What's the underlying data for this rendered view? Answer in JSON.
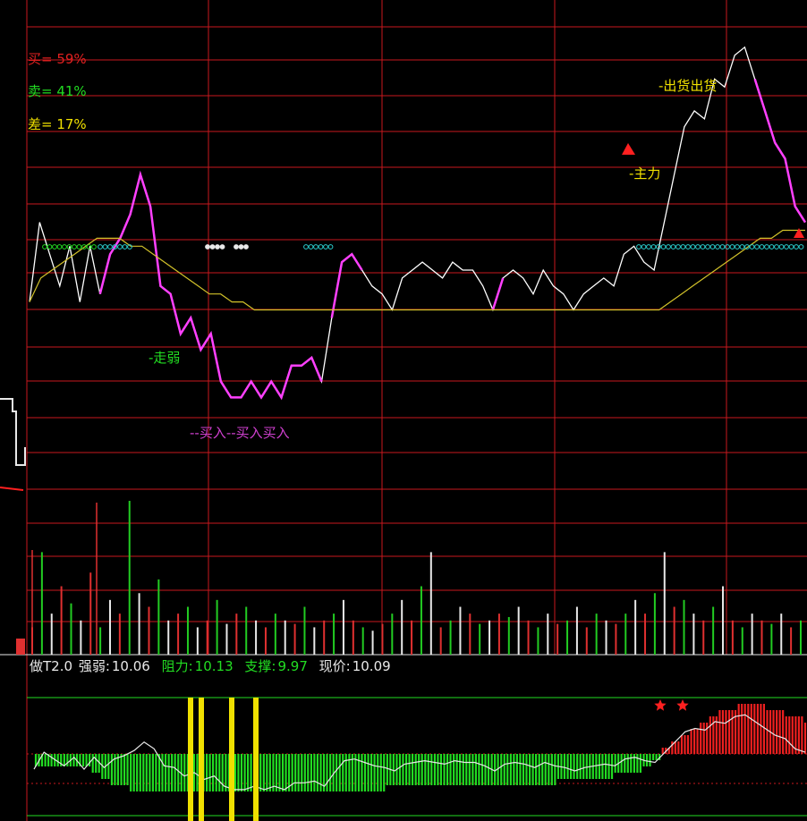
{
  "colors": {
    "background": "#000000",
    "grid_red": "#c8181e",
    "price_line": "#ffffff",
    "strong_segments": "#ff40ff",
    "avg_line": "#d2c22a",
    "green": "#22dd22",
    "cyan": "#2ad0d0",
    "yellow": "#f0e000",
    "white": "#e8e8e8"
  },
  "stats": {
    "buy_label": "买= 59%",
    "sell_label": "卖= 41%",
    "diff_label": "差= 17%"
  },
  "annotations": {
    "weak": "-走弱",
    "buy_in": "--买入--买入买入",
    "main_force": "-主力",
    "sell_out": "-出货出货"
  },
  "indicator": {
    "name": "做T2.0",
    "strength_label": "强弱:",
    "strength_value": "10.06",
    "resistance_label": "阻力:",
    "resistance_value": "10.13",
    "support_label": "支撑:",
    "support_value": "9.97",
    "price_label": "现价:",
    "price_value": "10.09"
  },
  "chart_data": {
    "type": "line",
    "series": [
      {
        "values": [
          9.96,
          10.06,
          10.02,
          9.98,
          10.03,
          9.96,
          10.03,
          9.97,
          10.02,
          10.04,
          10.07,
          10.12,
          10.08,
          9.98,
          9.97,
          9.92,
          9.94,
          9.9,
          9.92,
          9.86,
          9.84,
          9.84,
          9.86,
          9.84,
          9.86,
          9.84,
          9.88,
          9.88,
          9.89,
          9.86,
          9.94,
          10.01,
          10.02,
          10.0,
          9.98,
          9.97,
          9.95,
          9.99,
          10.0,
          10.01,
          10.0,
          9.99,
          10.01,
          10.0,
          10.0,
          9.98,
          9.95,
          9.99,
          10.0,
          9.99,
          9.97,
          10.0,
          9.98,
          9.97,
          9.95,
          9.97,
          9.98,
          9.99,
          9.98,
          10.02,
          10.03,
          10.01,
          10.0,
          10.06,
          10.12,
          10.18,
          10.2,
          10.19,
          10.24,
          10.23,
          10.27,
          10.28,
          10.24,
          10.2,
          10.16,
          10.14,
          10.08,
          10.06
        ]
      },
      {
        "values": [
          9.96,
          9.99,
          10.0,
          10.01,
          10.02,
          10.03,
          10.04,
          10.04,
          10.04,
          10.03,
          10.03,
          10.02,
          10.01,
          10.0,
          9.99,
          9.98,
          9.97,
          9.97,
          9.96,
          9.96,
          9.95,
          9.95,
          9.95,
          9.95,
          9.95,
          9.95,
          9.95,
          9.95,
          9.95,
          9.95,
          9.95,
          9.95,
          9.95,
          9.95,
          9.95,
          9.95,
          9.95,
          9.95,
          9.95,
          9.95,
          9.95,
          9.95,
          9.95,
          9.95,
          9.95,
          9.95,
          9.95,
          9.95,
          9.95,
          9.95,
          9.95,
          9.95,
          9.95,
          9.95,
          9.95,
          9.95,
          9.95,
          9.96,
          9.97,
          9.98,
          9.99,
          10.0,
          10.01,
          10.02,
          10.03,
          10.04,
          10.04,
          10.05,
          10.05,
          10.05
        ]
      }
    ],
    "volume": [
      8,
      30,
      12,
      20,
      15,
      10,
      24,
      8,
      16,
      12,
      45,
      18,
      14,
      22,
      10,
      12,
      14,
      8,
      10,
      16,
      9,
      12,
      14,
      10,
      8,
      12,
      10,
      9,
      14,
      8,
      10,
      12,
      16,
      10,
      8,
      7,
      9,
      12,
      16,
      10,
      20,
      30,
      8,
      10,
      14,
      12,
      9,
      10,
      12,
      11,
      14,
      10,
      8,
      12,
      9,
      10,
      14,
      8,
      12,
      10,
      9,
      12,
      16,
      12,
      18,
      30,
      14,
      16,
      12,
      10,
      14,
      20,
      10,
      8,
      12,
      10,
      9,
      12,
      8,
      10
    ],
    "osc": [
      2,
      2,
      2,
      2,
      2,
      2,
      3,
      4,
      5,
      5,
      6,
      6,
      6,
      6,
      6,
      6,
      6,
      6,
      6,
      6,
      6,
      6,
      6,
      6,
      6,
      6,
      6,
      6,
      6,
      6,
      6,
      6,
      6,
      6,
      6,
      6,
      6,
      5,
      5,
      5,
      5,
      5,
      5,
      5,
      5,
      5,
      5,
      5,
      5,
      5,
      5,
      5,
      5,
      5,
      5,
      4,
      4,
      4,
      4,
      4,
      4,
      3,
      3,
      3,
      2,
      1,
      -1,
      -2,
      -3,
      -4,
      -5,
      -6,
      -7,
      -7,
      -8,
      -8,
      -8,
      -7,
      -7,
      -6,
      -6,
      -5
    ]
  }
}
